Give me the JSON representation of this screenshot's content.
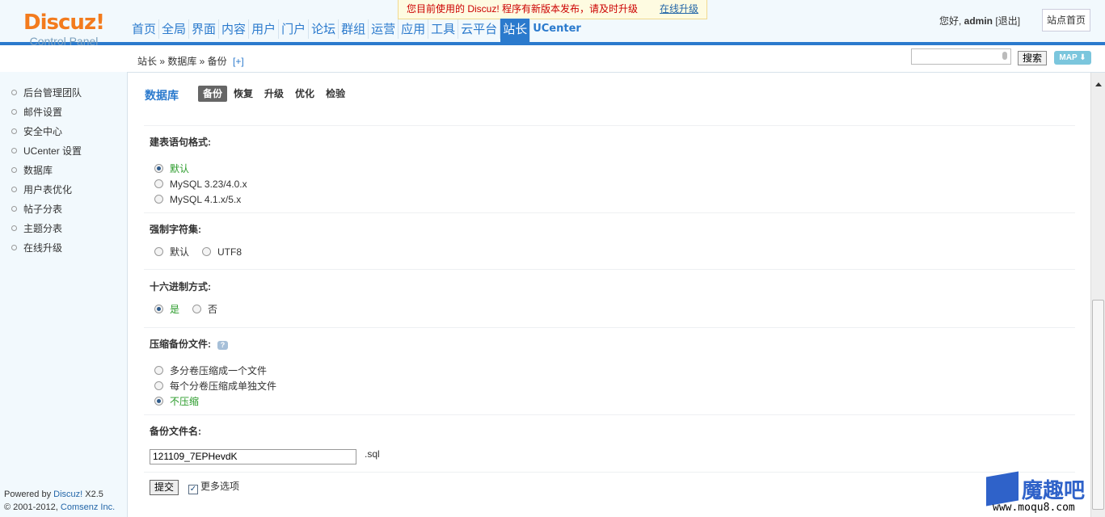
{
  "header": {
    "logo_brand": "Discuz!",
    "logo_sub": "Control Panel",
    "notice_text": "您目前使用的 Discuz! 程序有新版本发布，请及时升级",
    "notice_link": "在线升级",
    "nav": [
      "首页",
      "全局",
      "界面",
      "内容",
      "用户",
      "门户",
      "论坛",
      "群组",
      "运营",
      "应用",
      "工具",
      "云平台",
      "站长",
      "UCenter"
    ],
    "nav_active": "站长",
    "greeting": "您好, ",
    "username": "admin",
    "logout": "[退出]",
    "site_home": "站点首页"
  },
  "crumbbar": {
    "crumbs": "站长 » 数据库 » 备份",
    "add": "[+]",
    "search_placeholder": "",
    "search_button": "搜索",
    "map_button": "MAP ⬇"
  },
  "sidebar": {
    "items": [
      "后台管理团队",
      "邮件设置",
      "安全中心",
      "UCenter 设置",
      "数据库",
      "用户表优化",
      "帖子分表",
      "主题分表",
      "在线升级"
    ],
    "powered_line1_prefix": "Powered by ",
    "powered_brand": "Discuz!",
    "powered_version": " X2.5",
    "powered_line2_prefix": "© 2001-2012, ",
    "powered_company": "Comsenz Inc."
  },
  "main": {
    "title": "数据库",
    "tabs": [
      "备份",
      "恢复",
      "升级",
      "优化",
      "检验"
    ],
    "active_tab": "备份",
    "sql_format": {
      "label": "建表语句格式:",
      "options": [
        "默认",
        "MySQL 3.23/4.0.x",
        "MySQL 4.1.x/5.x"
      ],
      "selected": "默认"
    },
    "charset": {
      "label": "强制字符集:",
      "options": [
        "默认",
        "UTF8"
      ],
      "selected": ""
    },
    "hex": {
      "label": "十六进制方式:",
      "options": [
        "是",
        "否"
      ],
      "selected": "是"
    },
    "compress": {
      "label": "压缩备份文件:",
      "options": [
        "多分卷压缩成一个文件",
        "每个分卷压缩成单独文件",
        "不压缩"
      ],
      "selected": "不压缩"
    },
    "filename": {
      "label": "备份文件名:",
      "value": "121109_7EPHevdK",
      "ext": ".sql"
    },
    "submit": "提交",
    "more_options": "更多选项",
    "more_options_checked": true
  },
  "watermark": {
    "text": "魔趣吧",
    "url": "www.moqu8.com"
  },
  "colors": {
    "accent": "#2b7acd",
    "sidebar_bg": "#f2f9fd",
    "selected_text": "#2a9b2a",
    "logo_orange": "#f37b1d"
  }
}
